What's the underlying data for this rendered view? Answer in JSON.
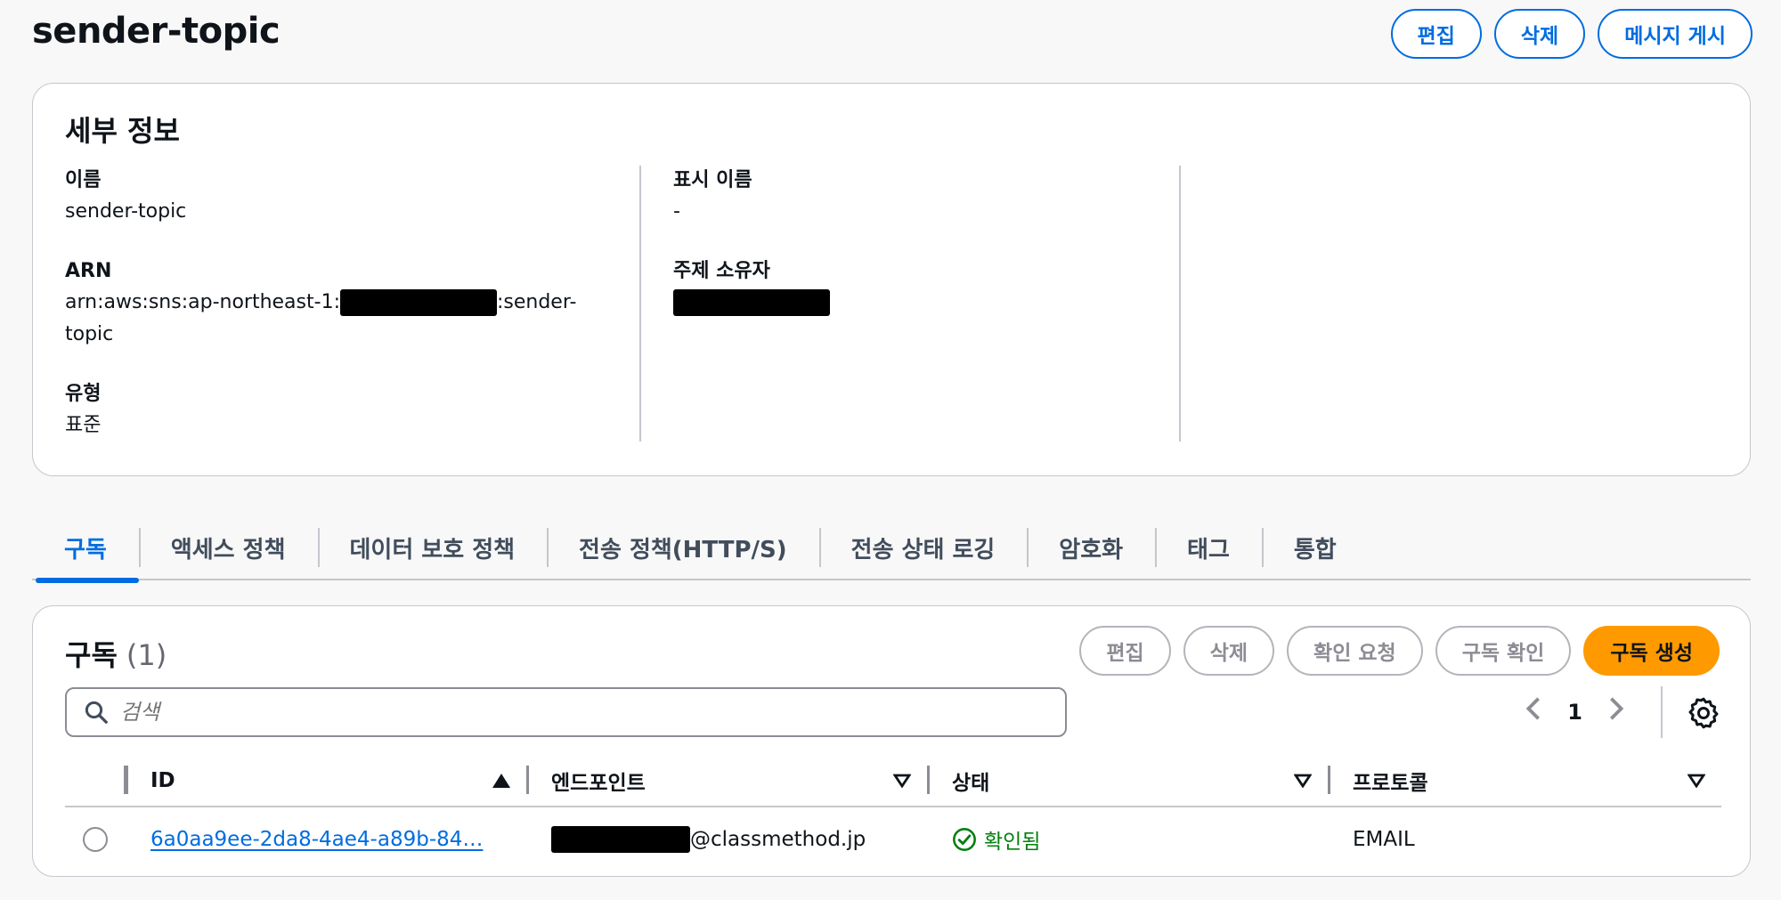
{
  "page": {
    "title": "sender-topic",
    "actions": {
      "edit": "편집",
      "delete": "삭제",
      "publish": "메시지 게시"
    }
  },
  "details": {
    "title": "세부 정보",
    "name_label": "이름",
    "name_value": "sender-topic",
    "arn_label": "ARN",
    "arn_prefix": "arn:aws:sns:ap-northeast-1:",
    "arn_suffix": ":sender-topic",
    "type_label": "유형",
    "type_value": "표준",
    "display_name_label": "표시 이름",
    "display_name_value": "-",
    "owner_label": "주제 소유자"
  },
  "tabs": [
    {
      "label": "구독",
      "active": true
    },
    {
      "label": "액세스 정책",
      "active": false
    },
    {
      "label": "데이터 보호 정책",
      "active": false
    },
    {
      "label": "전송 정책(HTTP/S)",
      "active": false
    },
    {
      "label": "전송 상태 로깅",
      "active": false
    },
    {
      "label": "암호화",
      "active": false
    },
    {
      "label": "태그",
      "active": false
    },
    {
      "label": "통합",
      "active": false
    }
  ],
  "subscriptions": {
    "title": "구독",
    "count": "(1)",
    "actions": {
      "edit": "편집",
      "delete": "삭제",
      "request_confirm": "확인 요청",
      "confirm": "구독 확인",
      "create": "구독 생성"
    },
    "search_placeholder": "검색",
    "page": "1",
    "columns": {
      "id": "ID",
      "endpoint": "엔드포인트",
      "status": "상태",
      "protocol": "프로토콜"
    },
    "rows": [
      {
        "id": "6a0aa9ee-2da8-4ae4-a89b-84…",
        "endpoint_suffix": "@classmethod.jp",
        "status": "확인됨",
        "protocol": "EMAIL"
      }
    ]
  },
  "colors": {
    "accent": "#006ce0",
    "primary": "#ff9900",
    "success": "#037f0c"
  },
  "icons": [
    "search-icon",
    "chevron-left-icon",
    "chevron-right-icon",
    "settings-gear-icon",
    "sort-ascending-icon",
    "sort-icon",
    "check-circle-icon"
  ]
}
